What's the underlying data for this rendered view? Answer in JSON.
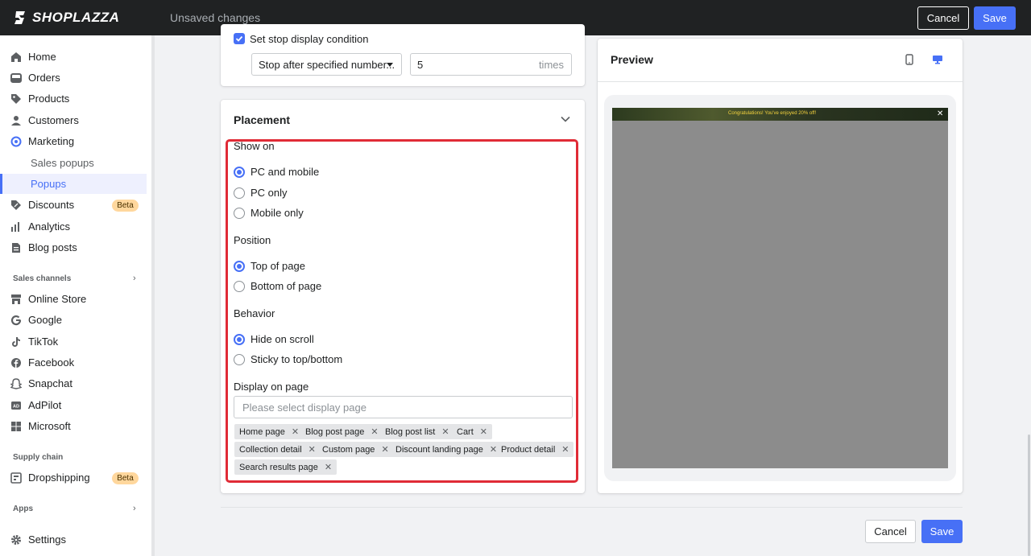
{
  "topbar": {
    "logo": "SHOPLAZZA",
    "status": "Unsaved changes",
    "cancel_label": "Cancel",
    "save_label": "Save"
  },
  "sidebar": {
    "items": [
      {
        "label": "Home",
        "icon": "home-icon"
      },
      {
        "label": "Orders",
        "icon": "orders-icon"
      },
      {
        "label": "Products",
        "icon": "tag-icon"
      },
      {
        "label": "Customers",
        "icon": "person-icon"
      },
      {
        "label": "Marketing",
        "icon": "target-icon"
      },
      {
        "label": "Sales popups"
      },
      {
        "label": "Popups"
      },
      {
        "label": "Discounts",
        "icon": "discount-icon",
        "badge": "Beta"
      },
      {
        "label": "Analytics",
        "icon": "bar-chart-icon"
      },
      {
        "label": "Blog posts",
        "icon": "document-icon"
      }
    ],
    "sales_channels_label": "Sales channels",
    "channels": [
      {
        "label": "Online Store",
        "icon": "store-icon"
      },
      {
        "label": "Google",
        "icon": "google-icon"
      },
      {
        "label": "TikTok",
        "icon": "tiktok-icon"
      },
      {
        "label": "Facebook",
        "icon": "facebook-icon"
      },
      {
        "label": "Snapchat",
        "icon": "snapchat-icon"
      },
      {
        "label": "AdPilot",
        "icon": "adpilot-icon"
      },
      {
        "label": "Microsoft",
        "icon": "microsoft-icon"
      }
    ],
    "supply_chain_label": "Supply chain",
    "dropshipping": {
      "label": "Dropshipping",
      "badge": "Beta"
    },
    "apps_label": "Apps",
    "settings_label": "Settings"
  },
  "stop_card": {
    "checkbox_label": "Set stop display condition",
    "select_value": "Stop after specified number...",
    "input_value": "5",
    "input_suffix": "times"
  },
  "placement": {
    "title": "Placement",
    "show_on": {
      "label": "Show on",
      "options": [
        "PC and mobile",
        "PC only",
        "Mobile only"
      ],
      "selected": "PC and mobile"
    },
    "position": {
      "label": "Position",
      "options": [
        "Top of page",
        "Bottom of page"
      ],
      "selected": "Top of page"
    },
    "behavior": {
      "label": "Behavior",
      "options": [
        "Hide on scroll",
        "Sticky to top/bottom"
      ],
      "selected": "Hide on scroll"
    },
    "display_on_page": {
      "label": "Display on page",
      "placeholder": "Please select display page",
      "tags": [
        "Home page",
        "Blog post page",
        "Blog post list",
        "Cart",
        "Collection detail",
        "Custom page",
        "Discount landing page",
        "Product detail",
        "Search results page"
      ]
    }
  },
  "preview": {
    "title": "Preview",
    "banner_text": "Congratulations! You've enjoyed 20% off!",
    "close_glyph": "✕"
  },
  "footer": {
    "cancel_label": "Cancel",
    "save_label": "Save"
  },
  "colors": {
    "accent": "#4770f6",
    "topbar": "#202223",
    "highlight": "#e02b36",
    "beta_badge": "#ffd79d"
  }
}
